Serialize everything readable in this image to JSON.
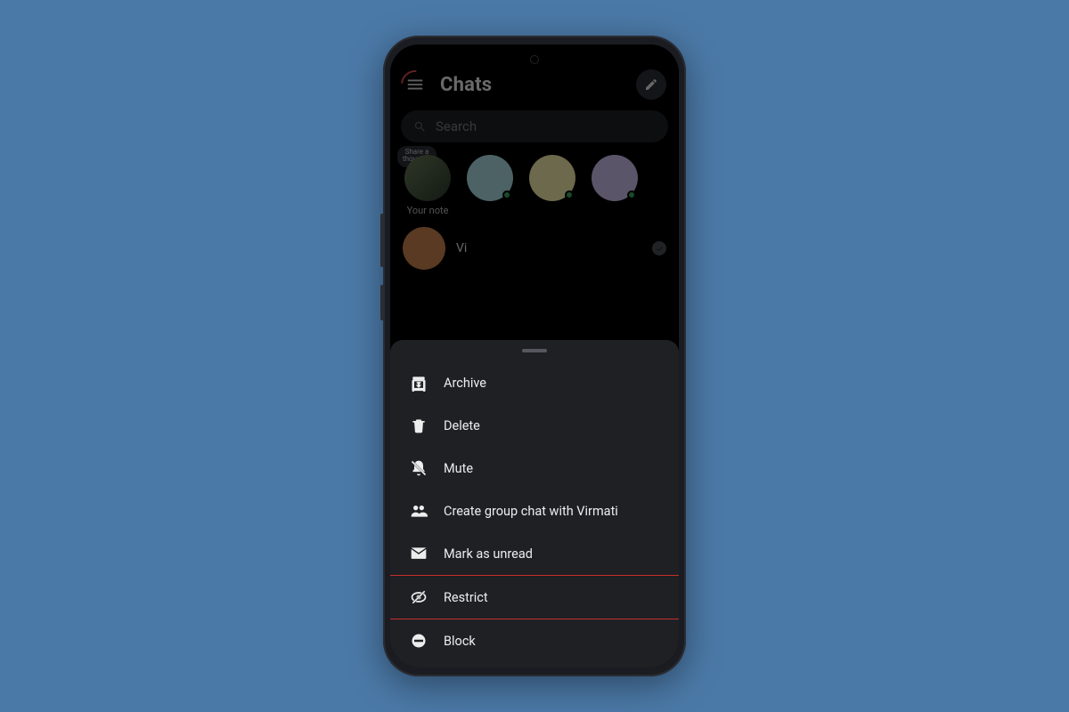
{
  "header": {
    "title": "Chats"
  },
  "search": {
    "placeholder": "Search"
  },
  "stories": {
    "your_note_bubble": "Share a\nthought...",
    "your_note_label": "Your note"
  },
  "chat": {
    "name": "Vi"
  },
  "sheet": {
    "items": [
      {
        "icon": "archive-icon",
        "label": "Archive"
      },
      {
        "icon": "trash-icon",
        "label": "Delete"
      },
      {
        "icon": "mute-icon",
        "label": "Mute"
      },
      {
        "icon": "group-icon",
        "label": "Create group chat with Virmati"
      },
      {
        "icon": "unread-icon",
        "label": "Mark as unread"
      },
      {
        "icon": "restrict-icon",
        "label": "Restrict"
      },
      {
        "icon": "block-icon",
        "label": "Block"
      }
    ],
    "highlighted_index": 5
  }
}
